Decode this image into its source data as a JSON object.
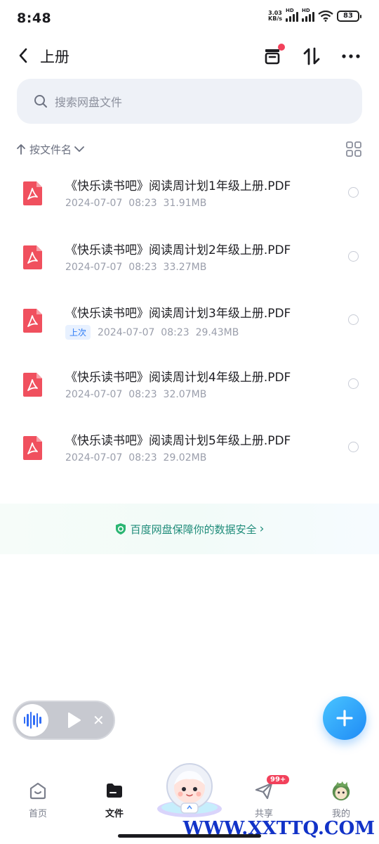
{
  "status_bar": {
    "time": "8:48",
    "net_speed_value": "3.03",
    "net_speed_unit": "KB/s",
    "signal1_label": "HD",
    "signal2_label": "HD",
    "battery": "83"
  },
  "header": {
    "title": "上册",
    "back_icon": "chevron-left-icon",
    "icons": [
      "archive-box-icon",
      "sort-arrows-icon",
      "more-icon"
    ]
  },
  "search": {
    "placeholder": "搜索网盘文件"
  },
  "sort": {
    "label": "按文件名"
  },
  "files": [
    {
      "name": "《快乐读书吧》阅读周计划1年级上册.PDF",
      "tag": "",
      "date": "2024-07-07",
      "time": "08:23",
      "size": "31.91MB"
    },
    {
      "name": "《快乐读书吧》阅读周计划2年级上册.PDF",
      "tag": "",
      "date": "2024-07-07",
      "time": "08:23",
      "size": "33.27MB"
    },
    {
      "name": "《快乐读书吧》阅读周计划3年级上册.PDF",
      "tag": "上次",
      "date": "2024-07-07",
      "time": "08:23",
      "size": "29.43MB"
    },
    {
      "name": "《快乐读书吧》阅读周计划4年级上册.PDF",
      "tag": "",
      "date": "2024-07-07",
      "time": "08:23",
      "size": "32.07MB"
    },
    {
      "name": "《快乐读书吧》阅读周计划5年级上册.PDF",
      "tag": "",
      "date": "2024-07-07",
      "time": "08:23",
      "size": "29.02MB"
    }
  ],
  "security_banner": {
    "text": "百度网盘保障你的数据安全"
  },
  "bottom_nav": {
    "items": [
      {
        "label": "首页"
      },
      {
        "label": "文件"
      },
      {
        "label": "共享",
        "badge": "99+"
      },
      {
        "label": "我的"
      }
    ]
  },
  "watermark": "WWW.XXTTQ.COM",
  "colors": {
    "accent": "#2f6cf6",
    "pdf_red": "#f0505e",
    "badge_red": "#f2415b",
    "security_green": "#1f8c7a"
  }
}
